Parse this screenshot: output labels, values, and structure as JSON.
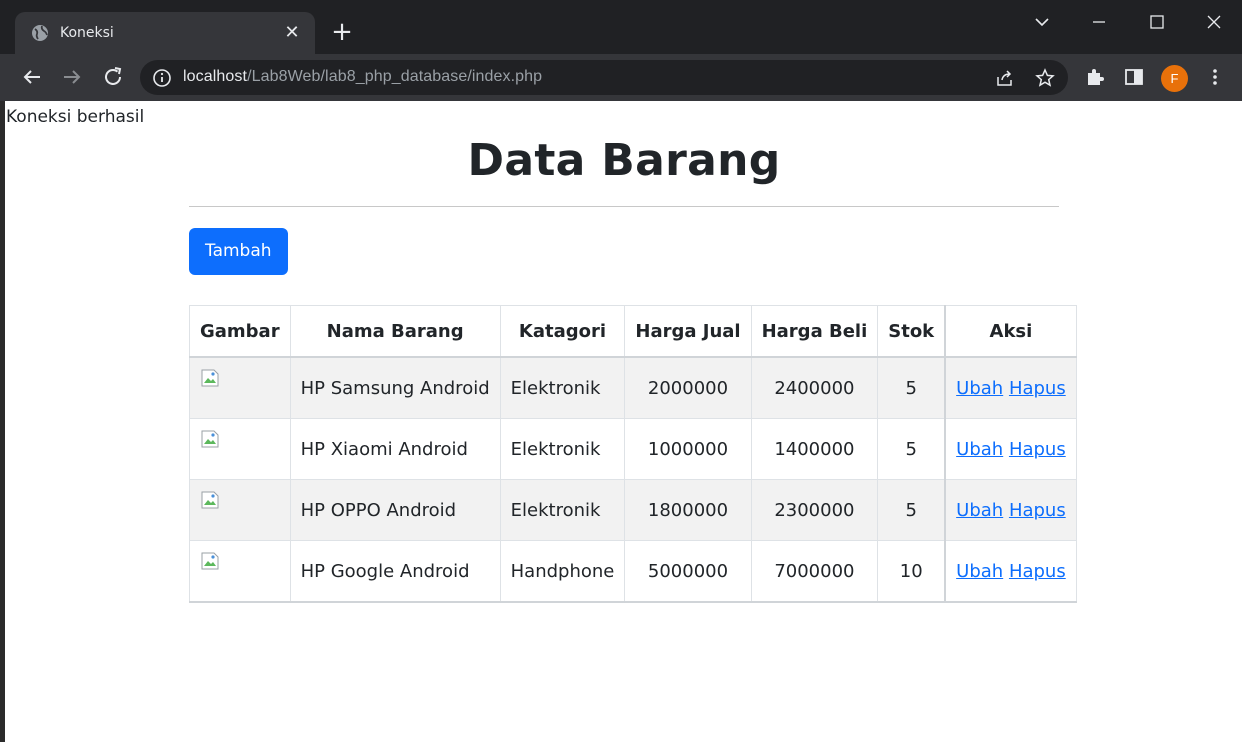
{
  "browser": {
    "tab_title": "Koneksi",
    "url_host": "localhost",
    "url_path": "/Lab8Web/lab8_php_database/index.php",
    "profile_initial": "F",
    "profile_color": "#e8710a"
  },
  "page": {
    "connection_message": "Koneksi berhasil",
    "title": "Data Barang",
    "add_button": "Tambah",
    "table": {
      "headers": [
        "Gambar",
        "Nama Barang",
        "Katagori",
        "Harga Jual",
        "Harga Beli",
        "Stok",
        "Aksi"
      ],
      "rows": [
        {
          "nama": "HP Samsung Android",
          "kategori": "Elektronik",
          "harga_jual": "2000000",
          "harga_beli": "2400000",
          "stok": "5",
          "ubah": "Ubah",
          "hapus": "Hapus"
        },
        {
          "nama": "HP Xiaomi Android",
          "kategori": "Elektronik",
          "harga_jual": "1000000",
          "harga_beli": "1400000",
          "stok": "5",
          "ubah": "Ubah",
          "hapus": "Hapus"
        },
        {
          "nama": "HP OPPO Android",
          "kategori": "Elektronik",
          "harga_jual": "1800000",
          "harga_beli": "2300000",
          "stok": "5",
          "ubah": "Ubah",
          "hapus": "Hapus"
        },
        {
          "nama": "HP Google Android",
          "kategori": "Handphone",
          "harga_jual": "5000000",
          "harga_beli": "7000000",
          "stok": "10",
          "ubah": "Ubah",
          "hapus": "Hapus"
        }
      ]
    }
  },
  "colors": {
    "primary": "#0d6efd",
    "chrome_dark": "#202124",
    "chrome_tab": "#35363a"
  }
}
